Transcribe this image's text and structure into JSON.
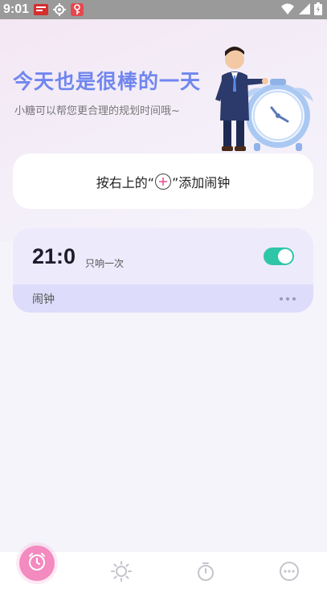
{
  "status_bar": {
    "time": "9:01",
    "icons": [
      "notification-app-icon",
      "settings-gear-icon",
      "key-icon"
    ],
    "right_icons": [
      "wifi-icon",
      "signal-icon",
      "battery-icon"
    ]
  },
  "hero": {
    "headline": "今天也是很棒的一天",
    "subline": "小糖可以帮您更合理的规划时间哦~",
    "illustration": "mascot-with-alarm-clock"
  },
  "hint": {
    "prefix": "按右上的“",
    "suffix": "”添加闹钟",
    "icon": "plus-circle-icon"
  },
  "alarm": {
    "time": "21:0",
    "repeat": "只响一次",
    "label": "闹钟",
    "enabled": true,
    "colors": {
      "toggle": "#2fc6a8",
      "card": "#edeafc",
      "footer": "#dddcfa"
    }
  },
  "nav": {
    "items": [
      {
        "icon": "alarm-clock-icon",
        "active": true
      },
      {
        "icon": "sun-icon",
        "active": false
      },
      {
        "icon": "stopwatch-icon",
        "active": false
      },
      {
        "icon": "more-icon",
        "active": false
      }
    ],
    "accent": "#f38ac0"
  }
}
